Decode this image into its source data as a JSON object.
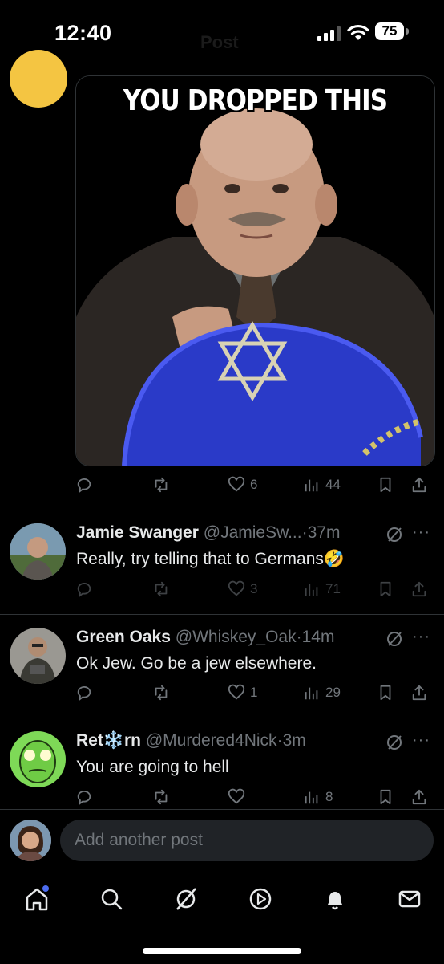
{
  "status_bar": {
    "time": "12:40",
    "battery": "75"
  },
  "header": {
    "title": "Post"
  },
  "main_post": {
    "image_caption": "YOU DROPPED THIS",
    "actions": {
      "replies": "",
      "reposts": "",
      "likes": "6",
      "views": "44"
    }
  },
  "replies": [
    {
      "name": "Jamie Swanger",
      "handle": "@JamieSw...",
      "time": "37m",
      "text": "Really, try telling that to Germans🤣",
      "actions": {
        "likes": "3",
        "views": "71"
      }
    },
    {
      "name": "Green Oaks",
      "handle": "@Whiskey_Oak",
      "time": "14m",
      "text": "Ok Jew. Go be a jew elsewhere.",
      "actions": {
        "likes": "1",
        "views": "29"
      }
    },
    {
      "name": "Ret❄️rn",
      "handle": "@Murdered4Nick",
      "time": "3m",
      "text": "You are going to hell",
      "actions": {
        "likes": "",
        "views": "8"
      }
    }
  ],
  "compose": {
    "placeholder": "Add another post"
  },
  "tab_bar": {
    "items": [
      "home-icon",
      "search-icon",
      "grok-icon",
      "video-icon",
      "notifications-icon",
      "messages-icon"
    ]
  },
  "colors": {
    "background": "#000000",
    "text": "#e7e9ea",
    "muted": "#71767b",
    "divider": "#2f3336",
    "accent": "#1d9bf0"
  }
}
